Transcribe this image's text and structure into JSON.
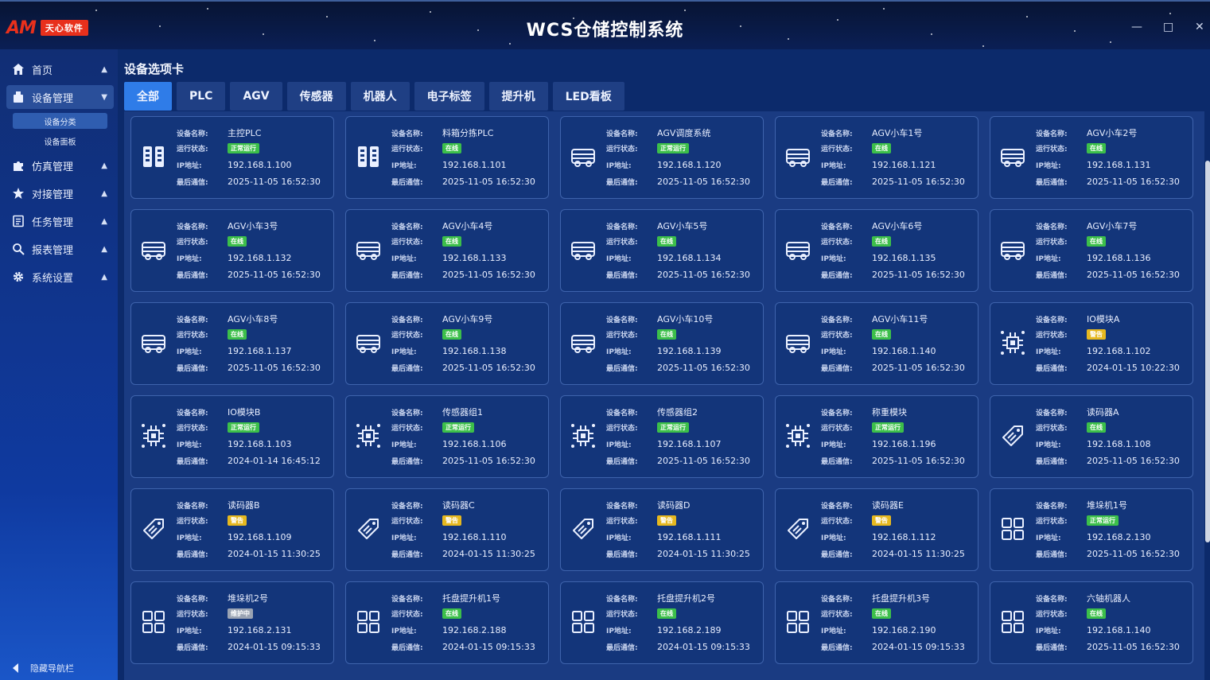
{
  "app": {
    "logo_text": "AM",
    "logo_tag": "天心软件",
    "title": "WCS仓储控制系统",
    "window_controls": [
      "—",
      "□",
      "✕"
    ]
  },
  "sidebar": {
    "items": [
      {
        "label": "首页",
        "icon": "home-icon",
        "caret": "^"
      },
      {
        "label": "设备管理",
        "icon": "device-icon",
        "caret": "v",
        "active": true
      },
      {
        "label": "仿真管理",
        "icon": "puzzle-icon",
        "caret": "^"
      },
      {
        "label": "对接管理",
        "icon": "star-icon",
        "caret": "^"
      },
      {
        "label": "任务管理",
        "icon": "list-icon",
        "caret": "^"
      },
      {
        "label": "报表管理",
        "icon": "search-icon",
        "caret": "^"
      },
      {
        "label": "系统设置",
        "icon": "gear-icon",
        "caret": "^"
      }
    ],
    "subitems": [
      {
        "label": "设备分类",
        "active": true
      },
      {
        "label": "设备面板"
      }
    ],
    "hide_label": "隐藏导航栏"
  },
  "main": {
    "section_title": "设备选项卡",
    "tabs": [
      {
        "label": "全部",
        "active": true
      },
      {
        "label": "PLC"
      },
      {
        "label": "AGV"
      },
      {
        "label": "传感器"
      },
      {
        "label": "机器人"
      },
      {
        "label": "电子标签"
      },
      {
        "label": "提升机"
      },
      {
        "label": "LED看板"
      }
    ]
  },
  "card_labels": {
    "name": "设备名称:",
    "status": "运行状态:",
    "ip": "IP地址:",
    "last": "最后通信:"
  },
  "status_colors": {
    "正常运行": "#3cbf4a",
    "在线": "#3cbf4a",
    "警告": "#e6b81f",
    "维护中": "#9aa3b3"
  },
  "devices": [
    {
      "name": "主控PLC",
      "status": "正常运行",
      "ip": "192.168.1.100",
      "last": "2025-11-05 16:52:30",
      "icon": "plc-icon"
    },
    {
      "name": "料箱分拣PLC",
      "status": "在线",
      "ip": "192.168.1.101",
      "last": "2025-11-05 16:52:30",
      "icon": "plc-icon"
    },
    {
      "name": "AGV调度系统",
      "status": "正常运行",
      "ip": "192.168.1.120",
      "last": "2025-11-05 16:52:30",
      "icon": "agv-icon"
    },
    {
      "name": "AGV小车1号",
      "status": "在线",
      "ip": "192.168.1.121",
      "last": "2025-11-05 16:52:30",
      "icon": "agv-icon"
    },
    {
      "name": "AGV小车2号",
      "status": "在线",
      "ip": "192.168.1.131",
      "last": "2025-11-05 16:52:30",
      "icon": "agv-icon"
    },
    {
      "name": "AGV小车3号",
      "status": "在线",
      "ip": "192.168.1.132",
      "last": "2025-11-05 16:52:30",
      "icon": "agv-icon"
    },
    {
      "name": "AGV小车4号",
      "status": "在线",
      "ip": "192.168.1.133",
      "last": "2025-11-05 16:52:30",
      "icon": "agv-icon"
    },
    {
      "name": "AGV小车5号",
      "status": "在线",
      "ip": "192.168.1.134",
      "last": "2025-11-05 16:52:30",
      "icon": "agv-icon"
    },
    {
      "name": "AGV小车6号",
      "status": "在线",
      "ip": "192.168.1.135",
      "last": "2025-11-05 16:52:30",
      "icon": "agv-icon"
    },
    {
      "name": "AGV小车7号",
      "status": "在线",
      "ip": "192.168.1.136",
      "last": "2025-11-05 16:52:30",
      "icon": "agv-icon"
    },
    {
      "name": "AGV小车8号",
      "status": "在线",
      "ip": "192.168.1.137",
      "last": "2025-11-05 16:52:30",
      "icon": "agv-icon"
    },
    {
      "name": "AGV小车9号",
      "status": "在线",
      "ip": "192.168.1.138",
      "last": "2025-11-05 16:52:30",
      "icon": "agv-icon"
    },
    {
      "name": "AGV小车10号",
      "status": "在线",
      "ip": "192.168.1.139",
      "last": "2025-11-05 16:52:30",
      "icon": "agv-icon"
    },
    {
      "name": "AGV小车11号",
      "status": "在线",
      "ip": "192.168.1.140",
      "last": "2025-11-05 16:52:30",
      "icon": "agv-icon"
    },
    {
      "name": "IO模块A",
      "status": "警告",
      "ip": "192.168.1.102",
      "last": "2024-01-15 10:22:30",
      "icon": "sensor-icon"
    },
    {
      "name": "IO模块B",
      "status": "正常运行",
      "ip": "192.168.1.103",
      "last": "2024-01-14 16:45:12",
      "icon": "sensor-icon"
    },
    {
      "name": "传感器组1",
      "status": "正常运行",
      "ip": "192.168.1.106",
      "last": "2025-11-05 16:52:30",
      "icon": "sensor-icon"
    },
    {
      "name": "传感器组2",
      "status": "正常运行",
      "ip": "192.168.1.107",
      "last": "2025-11-05 16:52:30",
      "icon": "sensor-icon"
    },
    {
      "name": "称重模块",
      "status": "正常运行",
      "ip": "192.168.1.196",
      "last": "2025-11-05 16:52:30",
      "icon": "sensor-icon"
    },
    {
      "name": "读码器A",
      "status": "在线",
      "ip": "192.168.1.108",
      "last": "2025-11-05 16:52:30",
      "icon": "tag-icon"
    },
    {
      "name": "读码器B",
      "status": "警告",
      "ip": "192.168.1.109",
      "last": "2024-01-15 11:30:25",
      "icon": "tag-icon"
    },
    {
      "name": "读码器C",
      "status": "警告",
      "ip": "192.168.1.110",
      "last": "2024-01-15 11:30:25",
      "icon": "tag-icon"
    },
    {
      "name": "读码器D",
      "status": "警告",
      "ip": "192.168.1.111",
      "last": "2024-01-15 11:30:25",
      "icon": "tag-icon"
    },
    {
      "name": "读码器E",
      "status": "警告",
      "ip": "192.168.1.112",
      "last": "2024-01-15 11:30:25",
      "icon": "tag-icon"
    },
    {
      "name": "堆垛机1号",
      "status": "正常运行",
      "ip": "192.168.2.130",
      "last": "2025-11-05 16:52:30",
      "icon": "grid-icon"
    },
    {
      "name": "堆垛机2号",
      "status": "维护中",
      "ip": "192.168.2.131",
      "last": "2024-01-15 09:15:33",
      "icon": "grid-icon"
    },
    {
      "name": "托盘提升机1号",
      "status": "在线",
      "ip": "192.168.2.188",
      "last": "2024-01-15 09:15:33",
      "icon": "grid-icon"
    },
    {
      "name": "托盘提升机2号",
      "status": "在线",
      "ip": "192.168.2.189",
      "last": "2024-01-15 09:15:33",
      "icon": "grid-icon"
    },
    {
      "name": "托盘提升机3号",
      "status": "在线",
      "ip": "192.168.2.190",
      "last": "2024-01-15 09:15:33",
      "icon": "grid-icon"
    },
    {
      "name": "六轴机器人",
      "status": "在线",
      "ip": "192.168.1.140",
      "last": "2025-11-05 16:52:30",
      "icon": "grid-icon"
    }
  ]
}
